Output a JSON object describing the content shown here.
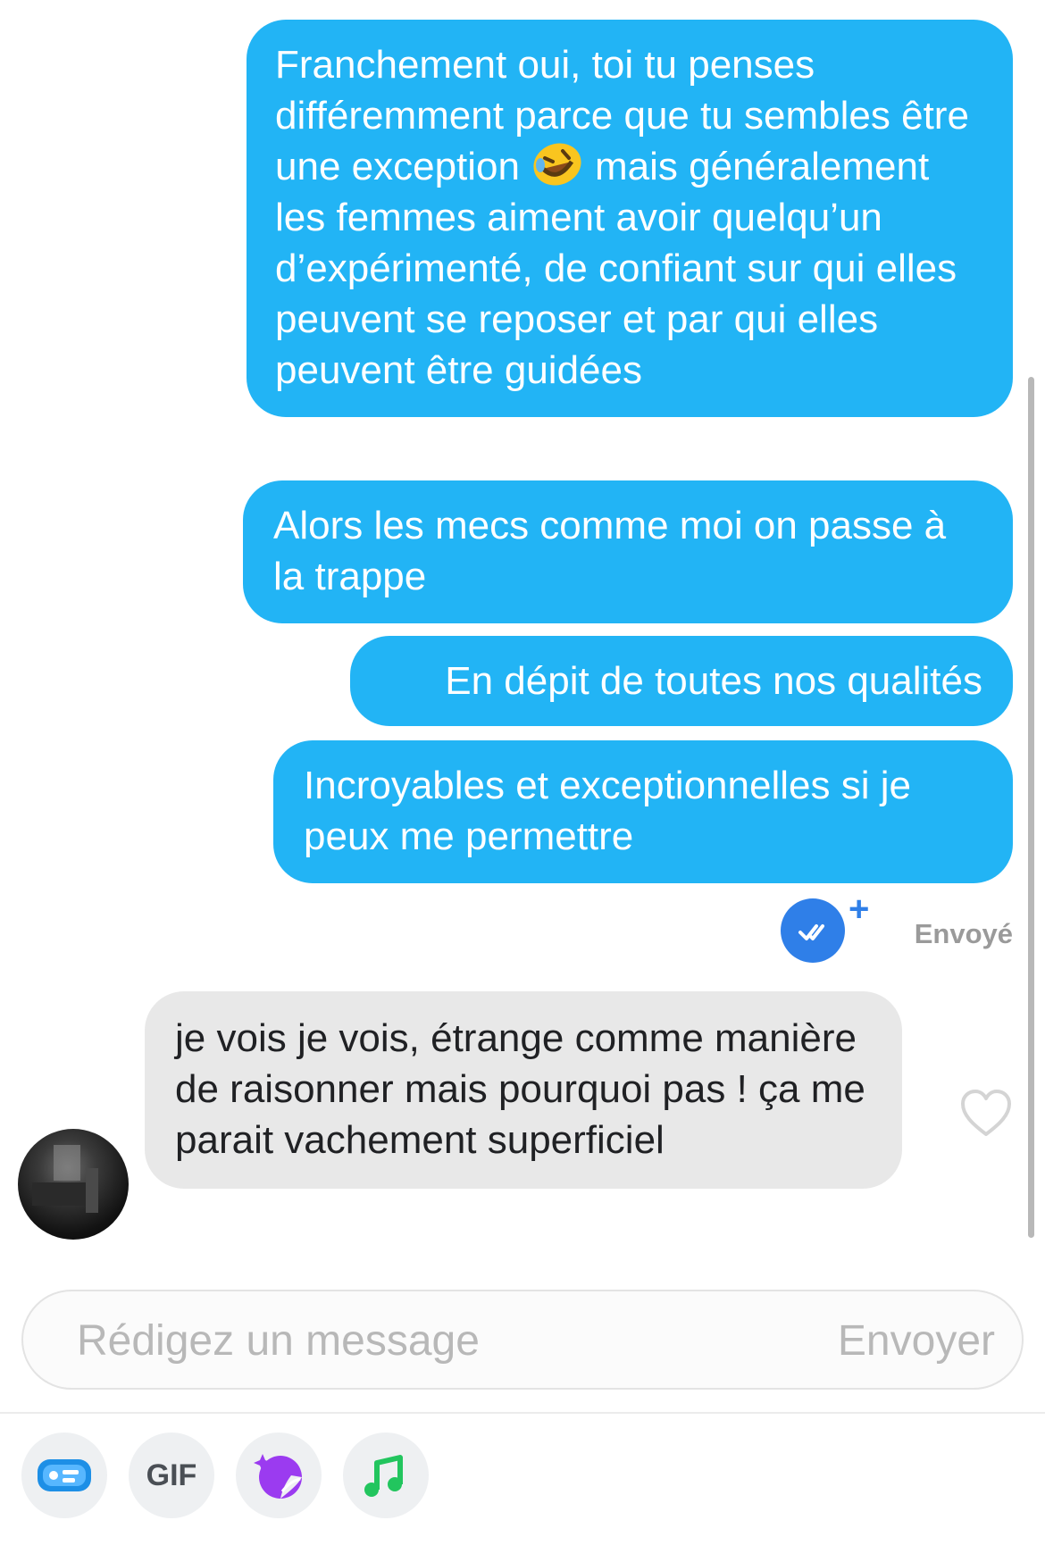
{
  "messages_out": [
    {
      "before_emoji": "Franchement oui, toi tu penses différemment parce que tu sembles être une exception",
      "emoji": "rolling-on-floor-laughing-emoji",
      "after_emoji": "mais généralement les femmes aiment avoir quelqu’un d’expérimenté, de confiant sur qui elles peuvent se reposer et par qui elles peuvent être guidées"
    },
    {
      "text": "Alors les mecs comme moi on passe à la trappe"
    },
    {
      "text": "En dépit de toutes nos qualités"
    },
    {
      "text": "Incroyables et exceptionnelles si je peux me permettre"
    }
  ],
  "status": {
    "label": "Envoyé",
    "icon": "double-check-icon",
    "plus": "+"
  },
  "message_in": {
    "text": "je vois je vois, étrange comme manière de raisonner mais pourquoi pas ! ça me parait vachement superficiel"
  },
  "composer": {
    "placeholder": "Rédigez un message",
    "send_label": "Envoyer"
  },
  "toolbar": {
    "items": [
      {
        "icon": "card-icon"
      },
      {
        "label": "GIF"
      },
      {
        "icon": "sticker-icon"
      },
      {
        "icon": "music-note-icon"
      }
    ]
  },
  "colors": {
    "bubble_out": "#22b4f5",
    "bubble_in": "#e8e8e8",
    "accent": "#2f7fe8"
  }
}
